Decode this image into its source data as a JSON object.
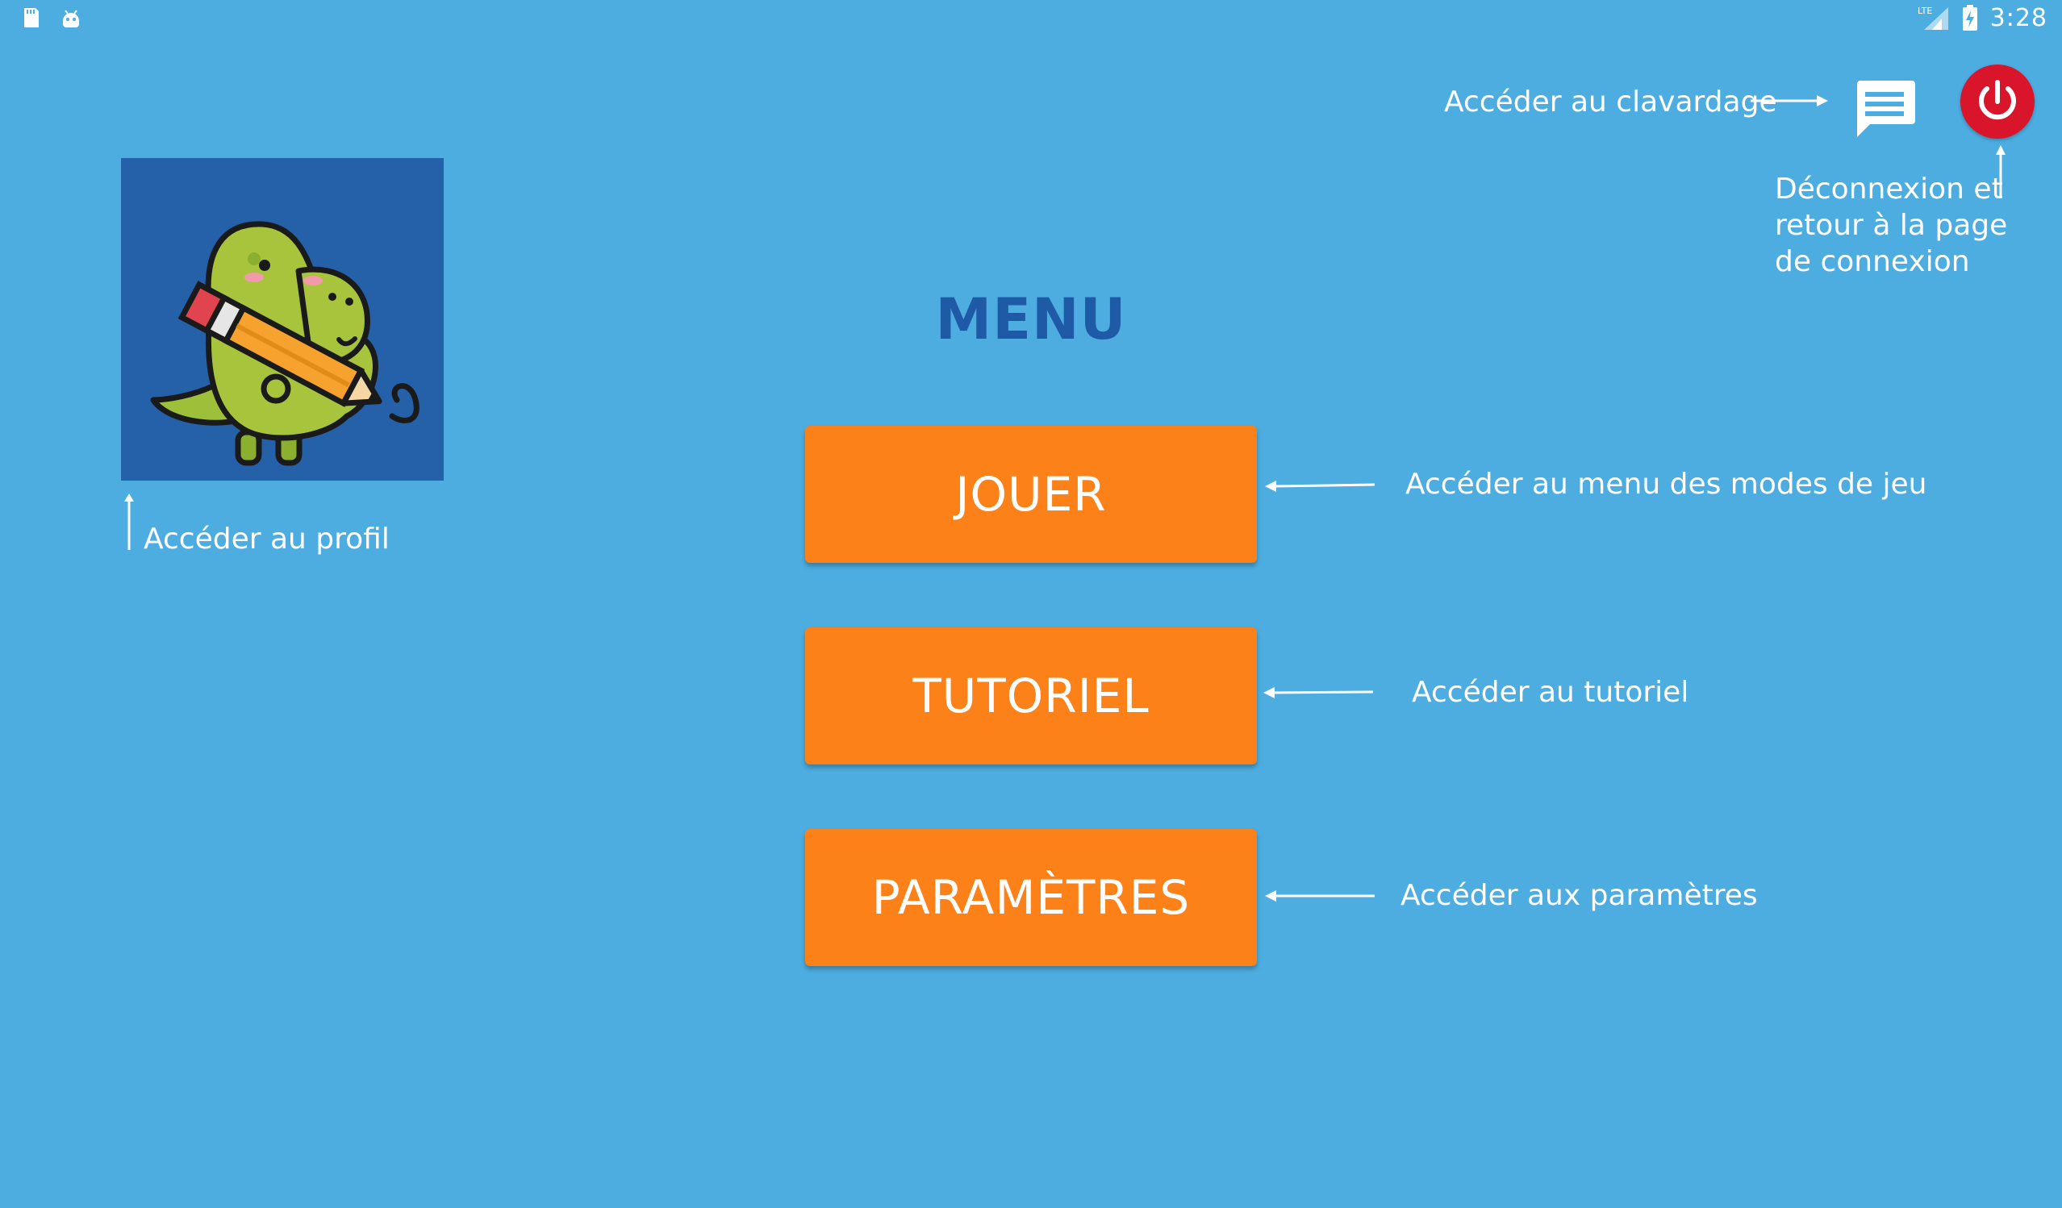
{
  "status_bar": {
    "time": "3:28",
    "network": "LTE",
    "left_icons": [
      "sd-card-icon",
      "android-debug-icon"
    ],
    "right_icons": [
      "signal-icon",
      "battery-charging-icon"
    ]
  },
  "menu": {
    "title": "MENU",
    "buttons": [
      {
        "label": "JOUER",
        "annotation": "Accéder au menu des modes de jeu"
      },
      {
        "label": "TUTORIEL",
        "annotation": "Accéder au tutoriel"
      },
      {
        "label": "PARAMÈTRES",
        "annotation": "Accéder aux paramètres"
      }
    ]
  },
  "profile": {
    "avatar_icon": "dinosaur-with-pencil-icon",
    "annotation": "Accéder au profil"
  },
  "chat": {
    "icon": "chat-icon",
    "annotation": "Accéder au clavardage"
  },
  "logout": {
    "icon": "power-icon",
    "annotation": "Déconnexion et retour à la page de connexion"
  },
  "colors": {
    "background": "#4dade0",
    "button": "#fd8119",
    "title": "#1f5aa6",
    "power": "#d8152a",
    "avatar_bg": "#2461a8"
  }
}
